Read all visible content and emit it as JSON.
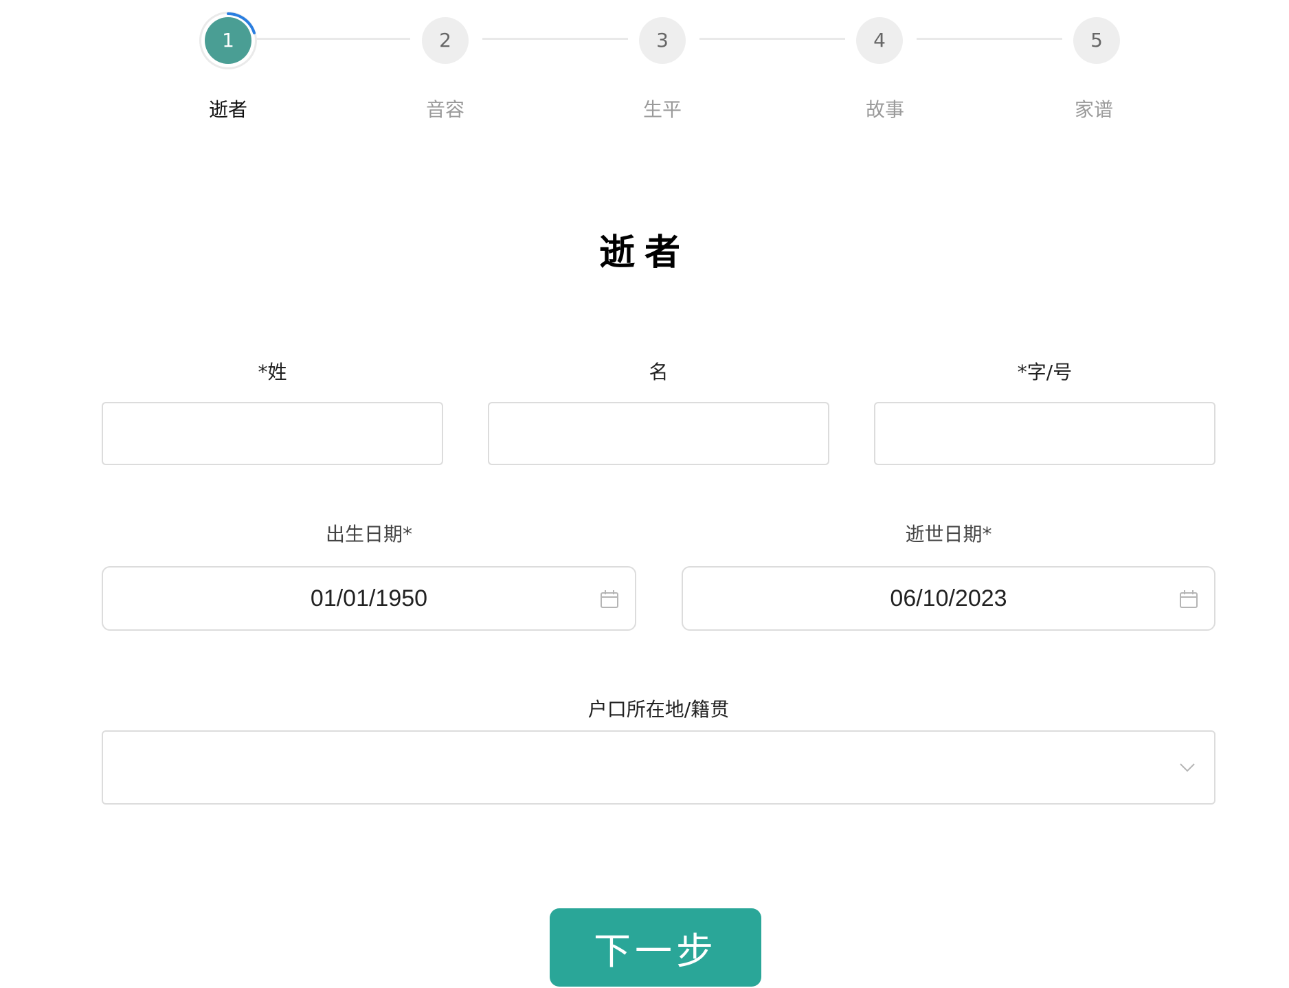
{
  "stepper": {
    "steps": [
      {
        "number": "1",
        "label": "逝者",
        "active": true
      },
      {
        "number": "2",
        "label": "音容",
        "active": false
      },
      {
        "number": "3",
        "label": "生平",
        "active": false
      },
      {
        "number": "4",
        "label": "故事",
        "active": false
      },
      {
        "number": "5",
        "label": "家谱",
        "active": false
      }
    ]
  },
  "section": {
    "title": "逝者"
  },
  "form": {
    "surname_label": "*姓",
    "surname_value": "",
    "given_name_label": "名",
    "given_name_value": "",
    "courtesy_name_label": "*字/号",
    "courtesy_name_value": "",
    "birth_date_label": "出生日期*",
    "birth_date_value": "01/01/1950",
    "death_date_label": "逝世日期*",
    "death_date_value": "06/10/2023",
    "hometown_label": "户口所在地/籍贯",
    "hometown_value": ""
  },
  "actions": {
    "next_label": "下一步"
  },
  "colors": {
    "accent": "#2aa698",
    "active_step": "#4a9e94",
    "progress_ring": "#2a7ee0",
    "inactive_step": "#eeeeee"
  },
  "icons": {
    "date_picker": "calendar-icon",
    "select": "chevron-down-icon"
  }
}
